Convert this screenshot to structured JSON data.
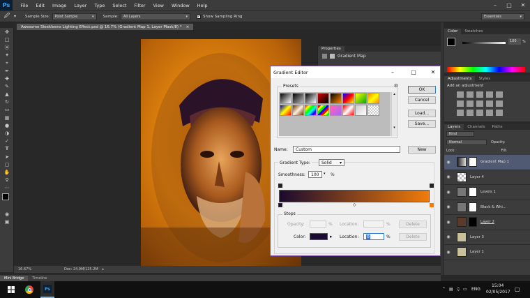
{
  "app": {
    "logo": "Ps"
  },
  "menu": [
    "File",
    "Edit",
    "Image",
    "Layer",
    "Type",
    "Select",
    "Filter",
    "View",
    "Window",
    "Help"
  ],
  "window_controls": {
    "minimize": "–",
    "maximize": "□",
    "close": "✕"
  },
  "options": {
    "sample_size_label": "Sample Size:",
    "sample_size_value": "Point Sample",
    "sample_label": "Sample:",
    "sample_value": "All Layers",
    "show_ring_label": "Show Sampling Ring",
    "workspace": "Essentials"
  },
  "document": {
    "tab_title": "Awesome Sleekleens Lighting Effect.psd @ 16.7% (Gradient Map 1, Layer Mask/8) *",
    "tab_close": "×",
    "zoom": "16.67%",
    "doc_info": "Doc: 24.9M/125.2M"
  },
  "mini_bridge": {
    "tabs": [
      "Mini Bridge",
      "Timeline"
    ]
  },
  "properties_panel": {
    "title": "Properties",
    "item": "Gradient Map"
  },
  "gradient_editor": {
    "title": "Gradient Editor",
    "presets_label": "Presets",
    "ok": "OK",
    "cancel": "Cancel",
    "load": "Load...",
    "save": "Save...",
    "name_label": "Name:",
    "name_value": "Custom",
    "new": "New",
    "gradient_type_label": "Gradient Type:",
    "gradient_type_value": "Solid",
    "smoothness_label": "Smoothness:",
    "smoothness_value": "100",
    "percent": "%",
    "stops_label": "Stops",
    "opacity_label": "Opacity:",
    "location_label": "Location:",
    "delete": "Delete",
    "color_label": "Color:",
    "color_location_value": "0",
    "color_hex": "#1b0a33",
    "start_color": "#1a0a2e",
    "end_color": "#f07c0a"
  },
  "color_panel": {
    "tabs": [
      "Color",
      "Swatches"
    ],
    "value": "100",
    "percent": "%"
  },
  "adjustments_panel": {
    "tabs": [
      "Adjustments",
      "Styles"
    ],
    "heading": "Add an adjustment"
  },
  "layers_panel": {
    "tabs": [
      "Layers",
      "Channels",
      "Paths"
    ],
    "kind": "Kind",
    "blend": "Normal",
    "opacity_label": "Opacity:",
    "lock_label": "Lock:",
    "fill_label": "Fill:",
    "layers": [
      {
        "name": "Gradient Map 1",
        "selected": true
      },
      {
        "name": "Layer 4",
        "selected": false
      },
      {
        "name": "Levels 1",
        "selected": false
      },
      {
        "name": "Black & Whi...",
        "selected": false
      },
      {
        "name": "Layer 2",
        "selected": false
      },
      {
        "name": "Layer 3",
        "selected": false
      },
      {
        "name": "Layer 1",
        "selected": false
      }
    ]
  },
  "taskbar": {
    "lang": "ENG",
    "time": "15:04",
    "date": "02/05/2017"
  }
}
